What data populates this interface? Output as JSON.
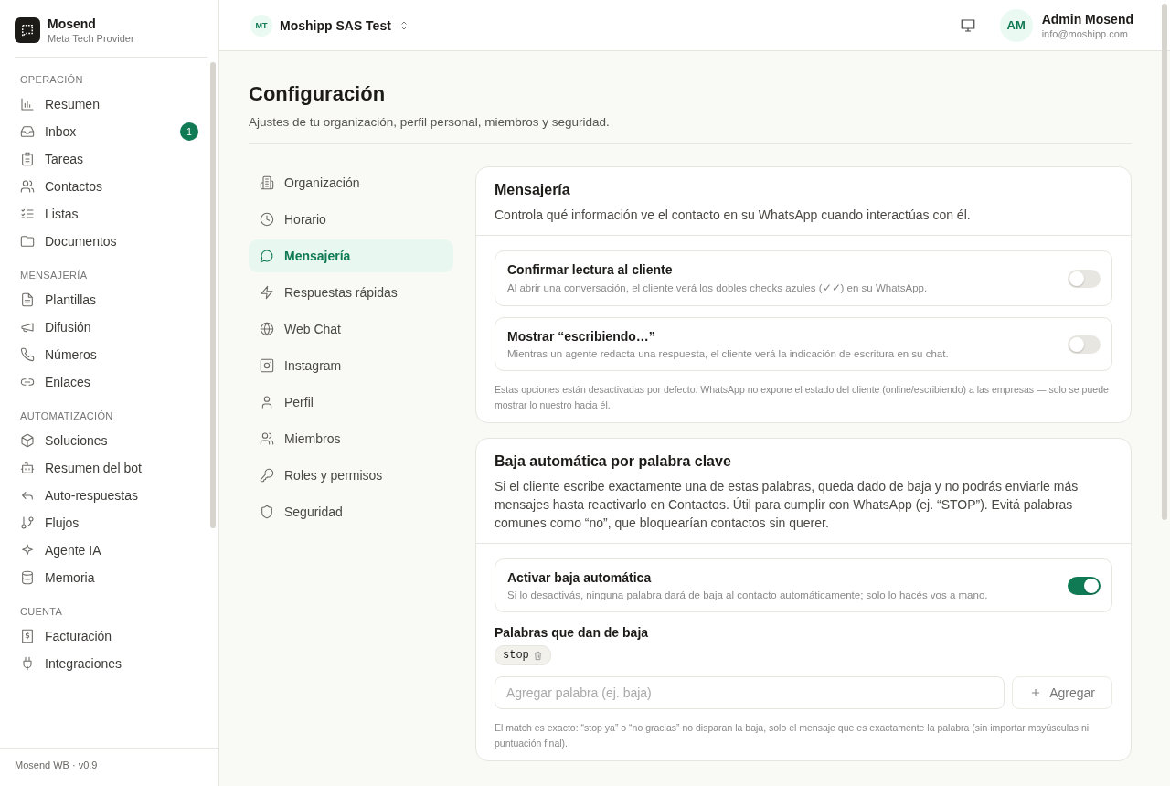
{
  "brand": {
    "name": "Mosend",
    "subtitle": "Meta Tech Provider"
  },
  "sidebar": {
    "sections": [
      {
        "label": "OPERACIÓN",
        "items": [
          {
            "label": "Resumen"
          },
          {
            "label": "Inbox",
            "badge": "1"
          },
          {
            "label": "Tareas"
          },
          {
            "label": "Contactos"
          },
          {
            "label": "Listas"
          },
          {
            "label": "Documentos"
          }
        ]
      },
      {
        "label": "MENSAJERÍA",
        "items": [
          {
            "label": "Plantillas"
          },
          {
            "label": "Difusión"
          },
          {
            "label": "Números"
          },
          {
            "label": "Enlaces"
          }
        ]
      },
      {
        "label": "AUTOMATIZACIÓN",
        "items": [
          {
            "label": "Soluciones"
          },
          {
            "label": "Resumen del bot"
          },
          {
            "label": "Auto-respuestas"
          },
          {
            "label": "Flujos"
          },
          {
            "label": "Agente IA"
          },
          {
            "label": "Memoria"
          }
        ]
      },
      {
        "label": "CUENTA",
        "items": [
          {
            "label": "Facturación"
          },
          {
            "label": "Integraciones"
          }
        ]
      }
    ],
    "footer": "Mosend WB · v0.9"
  },
  "topbar": {
    "org_initials": "MT",
    "org_name": "Moshipp SAS Test",
    "user_initials": "AM",
    "user_name": "Admin Mosend",
    "user_email": "info@moshipp.com"
  },
  "page": {
    "title": "Configuración",
    "subtitle": "Ajustes de tu organización, perfil personal, miembros y seguridad."
  },
  "settings_nav": [
    {
      "label": "Organización",
      "selected": false
    },
    {
      "label": "Horario",
      "selected": false
    },
    {
      "label": "Mensajería",
      "selected": true
    },
    {
      "label": "Respuestas rápidas",
      "selected": false
    },
    {
      "label": "Web Chat",
      "selected": false
    },
    {
      "label": "Instagram",
      "selected": false
    },
    {
      "label": "Perfil",
      "selected": false
    },
    {
      "label": "Miembros",
      "selected": false
    },
    {
      "label": "Roles y permisos",
      "selected": false
    },
    {
      "label": "Seguridad",
      "selected": false
    }
  ],
  "sections": [
    {
      "title": "Mensajería",
      "description": "Controla qué información ve el contacto en su WhatsApp cuando interactúas con él.",
      "toggles": [
        {
          "title": "Confirmar lectura al cliente",
          "description": "Al abrir una conversación, el cliente verá los dobles checks azules (✓✓) en su WhatsApp.",
          "on": false
        },
        {
          "title": "Mostrar “escribiendo…”",
          "description": "Mientras un agente redacta una respuesta, el cliente verá la indicación de escritura en su chat.",
          "on": false
        }
      ],
      "note": "Estas opciones están desactivadas por defecto. WhatsApp no expone el estado del cliente (online/escribiendo) a las empresas — solo se puede mostrar lo nuestro hacia él."
    },
    {
      "title": "Baja automática por palabra clave",
      "description": "Si el cliente escribe exactamente una de estas palabras, queda dado de baja y no podrás enviarle más mensajes hasta reactivarlo en Contactos. Útil para cumplir con WhatsApp (ej. “STOP”). Evitá palabras comunes como “no”, que bloquearían contactos sin querer.",
      "toggles": [
        {
          "title": "Activar baja automática",
          "description": "Si lo desactivás, ninguna palabra dará de baja al contacto automáticamente; solo lo hacés vos a mano.",
          "on": true
        }
      ],
      "keywords": {
        "label": "Palabras que dan de baja",
        "tags": [
          "stop"
        ],
        "input_placeholder": "Agregar palabra (ej. baja)",
        "add_button": "Agregar"
      },
      "note": "El match es exacto: “stop ya” o “no gracias” no disparan la baja, solo el mensaje que es exactamente la palabra (sin importar mayúsculas ni puntuación final)."
    }
  ]
}
